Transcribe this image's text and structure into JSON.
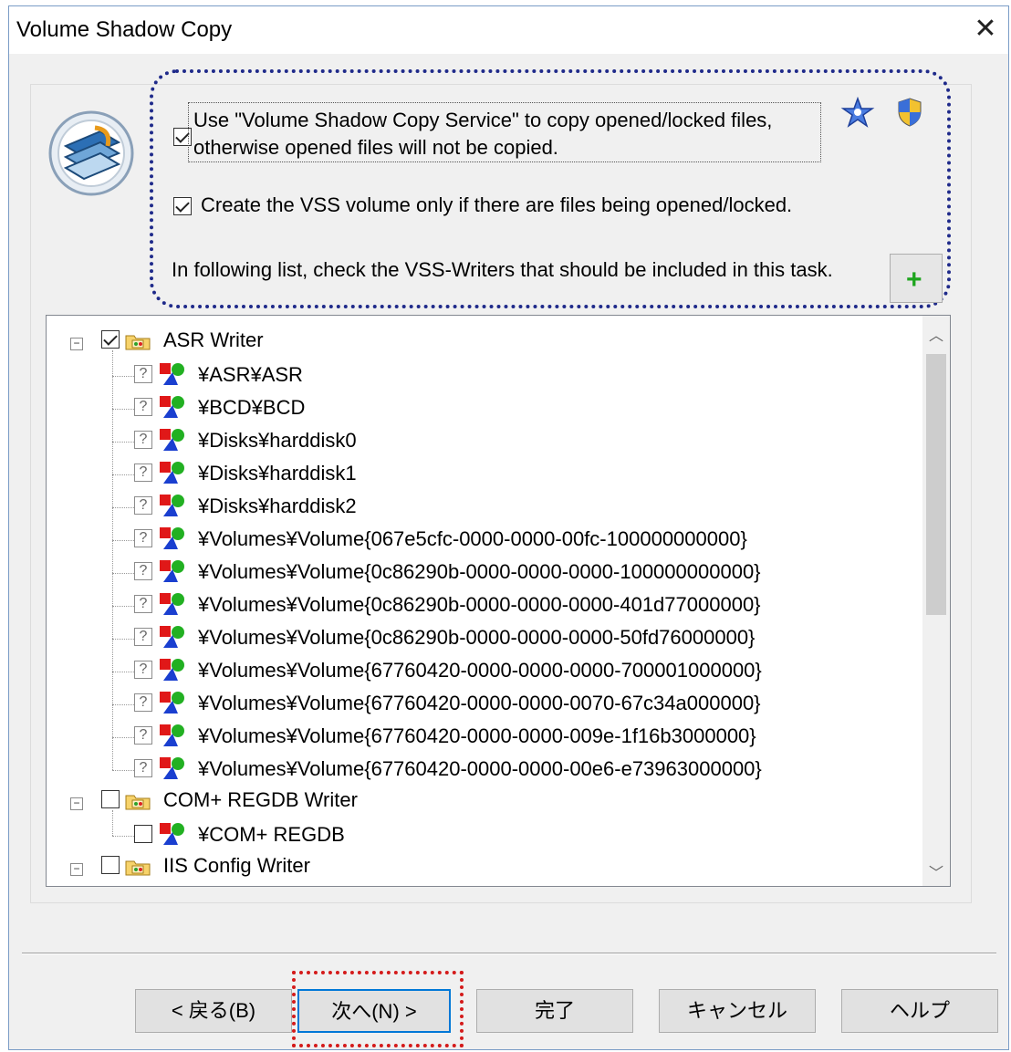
{
  "window": {
    "title": "Volume Shadow Copy"
  },
  "options": {
    "use_vss_line1": "Use \"Volume Shadow Copy Service\" to copy opened/locked files,",
    "use_vss_line2": "otherwise opened files will not be copied.",
    "use_vss_checked": true,
    "create_only_if_open": "Create the VSS volume only if there are files being opened/locked.",
    "create_only_if_open_checked": true,
    "writers_hint": "In following list, check the VSS-Writers that should be included in this task."
  },
  "tree": {
    "writers": [
      {
        "name": "ASR Writer",
        "checked": true,
        "components": [
          "¥ASR¥ASR",
          "¥BCD¥BCD",
          "¥Disks¥harddisk0",
          "¥Disks¥harddisk1",
          "¥Disks¥harddisk2",
          "¥Volumes¥Volume{067e5cfc-0000-0000-00fc-100000000000}",
          "¥Volumes¥Volume{0c86290b-0000-0000-0000-100000000000}",
          "¥Volumes¥Volume{0c86290b-0000-0000-0000-401d77000000}",
          "¥Volumes¥Volume{0c86290b-0000-0000-0000-50fd76000000}",
          "¥Volumes¥Volume{67760420-0000-0000-0000-700001000000}",
          "¥Volumes¥Volume{67760420-0000-0000-0070-67c34a000000}",
          "¥Volumes¥Volume{67760420-0000-0000-009e-1f16b3000000}",
          "¥Volumes¥Volume{67760420-0000-0000-00e6-e73963000000}"
        ]
      },
      {
        "name": "COM+ REGDB Writer",
        "checked": false,
        "components": [
          "¥COM+ REGDB"
        ]
      },
      {
        "name": "IIS Config Writer",
        "checked": false,
        "components": []
      }
    ]
  },
  "buttons": {
    "back": "< 戻る(B)",
    "next": "次へ(N) >",
    "finish": "完了",
    "cancel": "キャンセル",
    "help": "ヘルプ"
  },
  "colors": {
    "highlight_dotted": "#1f2a8a",
    "next_highlight": "#d41b1b",
    "default_button": "#0078d7"
  },
  "icons": [
    "close-icon",
    "vss-app-icon",
    "wizard-star-icon",
    "uac-shield-icon",
    "plus-icon",
    "folder-writer-icon",
    "question-icon",
    "vss-component-icon"
  ]
}
